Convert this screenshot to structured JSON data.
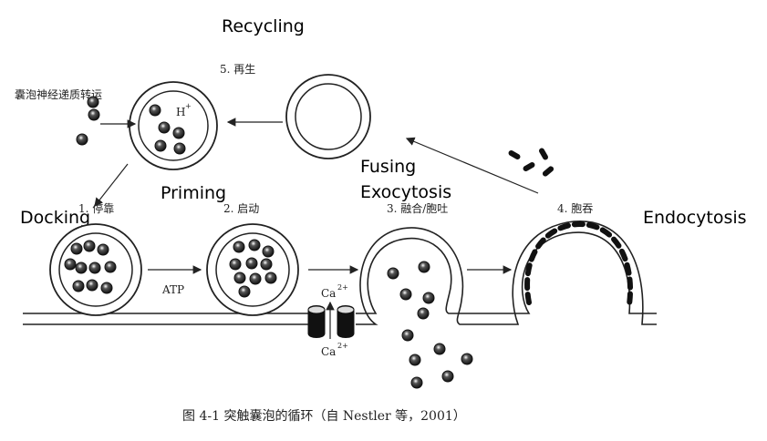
{
  "labels": {
    "recycling": "Recycling",
    "priming": "Priming",
    "docking": "Docking",
    "fusing": "Fusing",
    "exocytosis": "Exocytosis",
    "endocytosis": "Endocytosis"
  },
  "steps": {
    "recycle": "5. 再生",
    "transport": "囊泡神经递质转运",
    "dock": "1. 停靠",
    "prime": "2. 启动",
    "fuse": "3. 融合/胞吐",
    "endo": "4. 胞吞"
  },
  "annotations": {
    "proton": "H",
    "proton_sup": "+",
    "atp": "ATP",
    "calcium": "Ca",
    "calcium_sup": "2+",
    "calcium_in": "Ca",
    "calcium_in_sup": "2+"
  },
  "caption": "图 4-1   突触囊泡的循环（自 Nestler 等，2001）"
}
